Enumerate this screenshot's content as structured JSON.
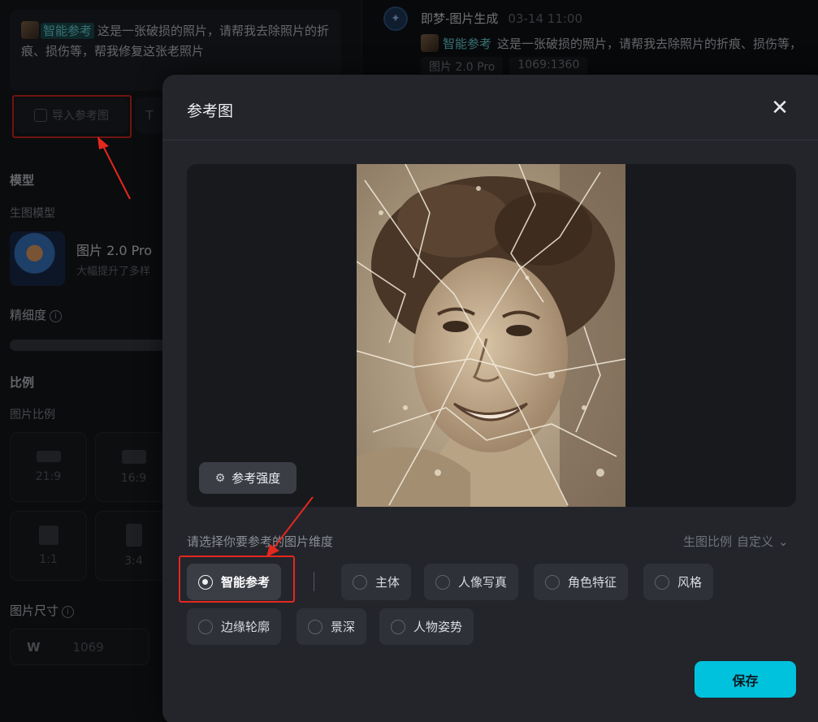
{
  "left_panel": {
    "prompt_tag": "智能参考",
    "prompt_text": "这是一张破损的照片，请帮我去除照片的折痕、损伤等，帮我修复这张老照片",
    "import_button": "导入参考图",
    "text_button_glyph": "T",
    "model_section": "模型",
    "gen_model_label": "生图模型",
    "model_name": "图片 2.0 Pro",
    "model_desc": "大幅提升了多样",
    "precision_label": "精细度",
    "ratio_section": "比例",
    "image_ratio_label": "图片比例",
    "ratios": [
      "21:9",
      "16:9",
      "1:1",
      "3:4"
    ],
    "size_label": "图片尺寸",
    "size_w_label": "W",
    "size_w_value": "1069"
  },
  "chat": {
    "bot_name": "即梦-图片生成",
    "time": "03-14  11:00",
    "prompt_tag": "智能参考",
    "prompt_text": "这是一张破损的照片，请帮我去除照片的折痕、损伤等，",
    "model_chip": "图片 2.0 Pro",
    "size_chip": "1069:1360"
  },
  "modal": {
    "title": "参考图",
    "close_glyph": "✕",
    "strength_button": "参考强度",
    "dimension_prompt": "请选择你要参考的图片维度",
    "ratio_select_label": "生图比例",
    "ratio_select_value": "自定义",
    "options": [
      "智能参考",
      "主体",
      "人像写真",
      "角色特征",
      "风格",
      "边缘轮廓",
      "景深",
      "人物姿势"
    ],
    "selected_option": "智能参考",
    "save_button": "保存"
  },
  "colors": {
    "accent": "#00c2dd",
    "highlight": "#e4281f",
    "modal_bg": "#23252b"
  }
}
